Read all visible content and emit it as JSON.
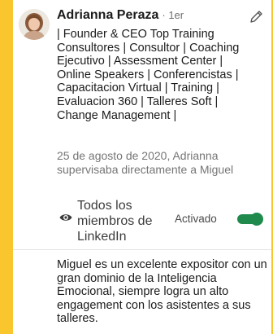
{
  "recommendation": {
    "name": "Adrianna Peraza",
    "degree": "· 1er",
    "headline": "| Founder & CEO Top Training Consultores | Consultor | Coaching Ejecutivo | Assessment Center | Online Speakers | Conferencistas | Capacitacion Virtual | Training | Evaluacion 360 | Talleres Soft | Change Management |",
    "meta": "25 de agosto de 2020, Adrianna supervisaba directamente a Miguel",
    "visibility_label": "Todos los miembros de LinkedIn",
    "toggle_label": "Activado",
    "toggle_on": true,
    "text": "Miguel es un excelente expositor con un gran dominio de la Inteligencia Emocional, siempre logra un alto engagement con los asistentes a sus talleres."
  },
  "icons": {
    "edit": "pencil-icon",
    "visibility": "eye-icon"
  },
  "colors": {
    "background": "#f9c72d",
    "card": "#ffffff",
    "toggle": "#1f8a4c",
    "muted_text": "#757575"
  }
}
